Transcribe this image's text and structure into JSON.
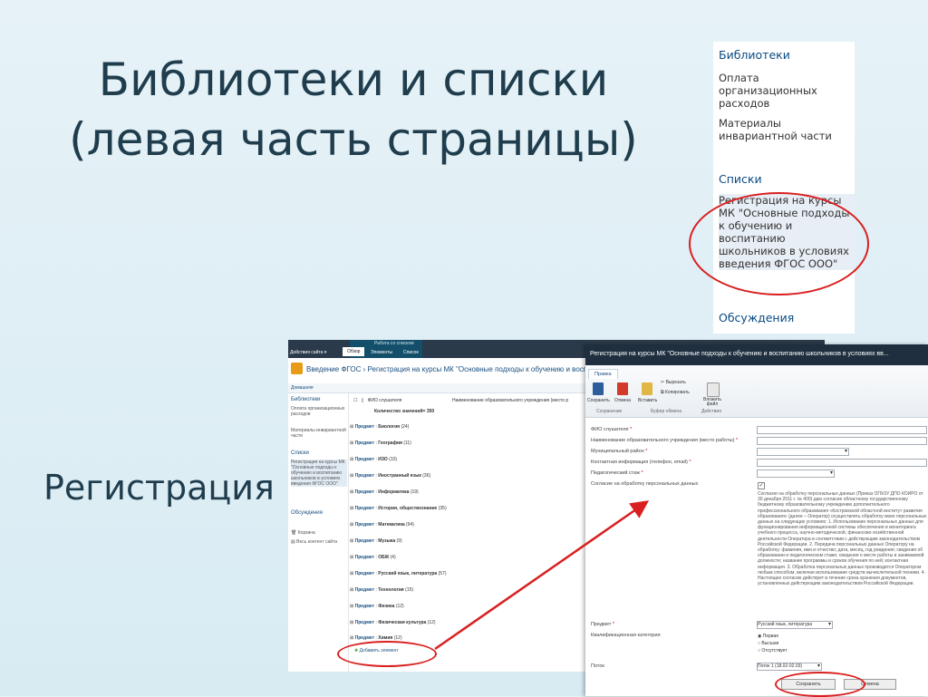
{
  "slide": {
    "title_line1": "Библиотеки и списки",
    "title_line2": "(левая часть страницы)",
    "subtitle": "Регистрация"
  },
  "crop": {
    "libraries_heading": "Библиотеки",
    "lib_item1": "Оплата организационных расходов",
    "lib_item2": "Материалы инвариантной части",
    "lists_heading": "Списки",
    "list_item1": "Регистрация на курсы МК \"Основные подходы к обучению и воспитанию школьников в условиях введения ФГОС ООО\"",
    "discussions_heading": "Обсуждения"
  },
  "shot": {
    "ribbon": {
      "site_actions": "Действия сайта ▾",
      "context_label": "Работа со списком",
      "tab_overview": "Обзор",
      "tab_items": "Элементы",
      "tab_list": "Список"
    },
    "breadcrumb": "Введение ФГОС › Регистрация на курсы МК \"Основные подходы к обучению и воспит",
    "home_tab": "Домашняя",
    "nav": {
      "libraries": "Библиотеки",
      "lib1": "Оплата организационных расходов",
      "lib2": "Материалы инвариантной части",
      "lists": "Списки",
      "list1": "Регистрация на курсы МК \"Основные подходы к обучению и воспитанию школьников в условиях введения ФГОС ООО\"",
      "discussions": "Обсуждения",
      "recycle": "Корзина",
      "all_content": "Весь контент сайта"
    },
    "col_name": "ФИО слушателя",
    "col_org": "Наименование образовательного учреждения (место р",
    "count_label": "Количество значений= 350",
    "groups": [
      {
        "label": "Биология",
        "count": "(24)"
      },
      {
        "label": "География",
        "count": "(11)"
      },
      {
        "label": "ИЗО",
        "count": "(10)"
      },
      {
        "label": "Иностранный язык",
        "count": "(36)"
      },
      {
        "label": "Информатика",
        "count": "(19)"
      },
      {
        "label": "История, обществознание",
        "count": "(35)"
      },
      {
        "label": "Математика",
        "count": "(94)"
      },
      {
        "label": "Музыка",
        "count": "(9)"
      },
      {
        "label": "ОБЖ",
        "count": "(4)"
      },
      {
        "label": "Русский язык, литература",
        "count": "(57)"
      },
      {
        "label": "Технология",
        "count": "(15)"
      },
      {
        "label": "Физика",
        "count": "(12)"
      },
      {
        "label": "Физическая культура",
        "count": "(12)"
      },
      {
        "label": "Химия",
        "count": "(12)"
      }
    ],
    "group_prefix": "Предмет",
    "add_item": "Добавить элемент"
  },
  "dialog": {
    "title": "Регистрация на курсы МК \"Основные подходы к обучению и воспитанию школьников в условиях вв...",
    "tab": "Правка",
    "btn_save": "Сохранить",
    "btn_cancel": "Отмена",
    "btn_paste": "Вставить",
    "btn_cut": "Вырезать",
    "btn_copy": "Копировать",
    "btn_attach": "Вложить файл",
    "grp_commit": "Сохранение",
    "grp_clipboard": "Буфер обмена",
    "grp_actions": "Действия",
    "fields": {
      "fio": "ФИО слушателя",
      "org": "Наименование образовательного учреждения (место работы)",
      "district": "Муниципальный район",
      "contact": "Контактная информация (телефон, email)",
      "experience": "Педагогический стаж",
      "consent": "Согласие на обработку персональных данных",
      "subject": "Предмет",
      "category": "Квалификационная категория",
      "stream": "Поток"
    },
    "consent_text": "Согласие на обработку персональных данных (Приказ ОГБОУ ДПО КОИРО от 30 декабря 2011 г. № 400) даю согласие областному государственному бюджетному образовательному учреждению дополнительного профессионального образования «Костромской областной институт развития образования» (далее – Оператор) осуществлять обработку моих персональных данных на следующих условиях: 1. Использование персональных данных для функционирования информационной системы обеспечения и мониторинга учебного процесса, научно-методической, финансово-хозяйственной деятельности Оператора в соответствии с действующим законодательством Российской Федерации. 2. Передача персональных данных Оператору на обработку: фамилия, имя и отчество; дата, месяц, год рождения; сведения об образовании и педагогическом стаже; сведения о месте работы и занимаемой должности; название программы и сроков обучения по ней; контактная информация. 3. Обработка персональных данных производится Оператором любым способом, включая использование средств вычислительной техники. 4. Настоящее согласие действует в течение срока хранения документов, установленных действующим законодательством Российской Федерации.",
    "subject_value": "Русский язык, литература",
    "cat_opt1": "Первая",
    "cat_opt2": "Высшая",
    "cat_opt3": "Отсутствует",
    "stream_value": "Поток 1 (18.02-02.03)",
    "save": "Сохранить",
    "cancel": "Отмена"
  },
  "colors": {
    "slide_title": "#1f3d4d",
    "link": "#0a4a83",
    "highlight": "#d91f1f"
  }
}
